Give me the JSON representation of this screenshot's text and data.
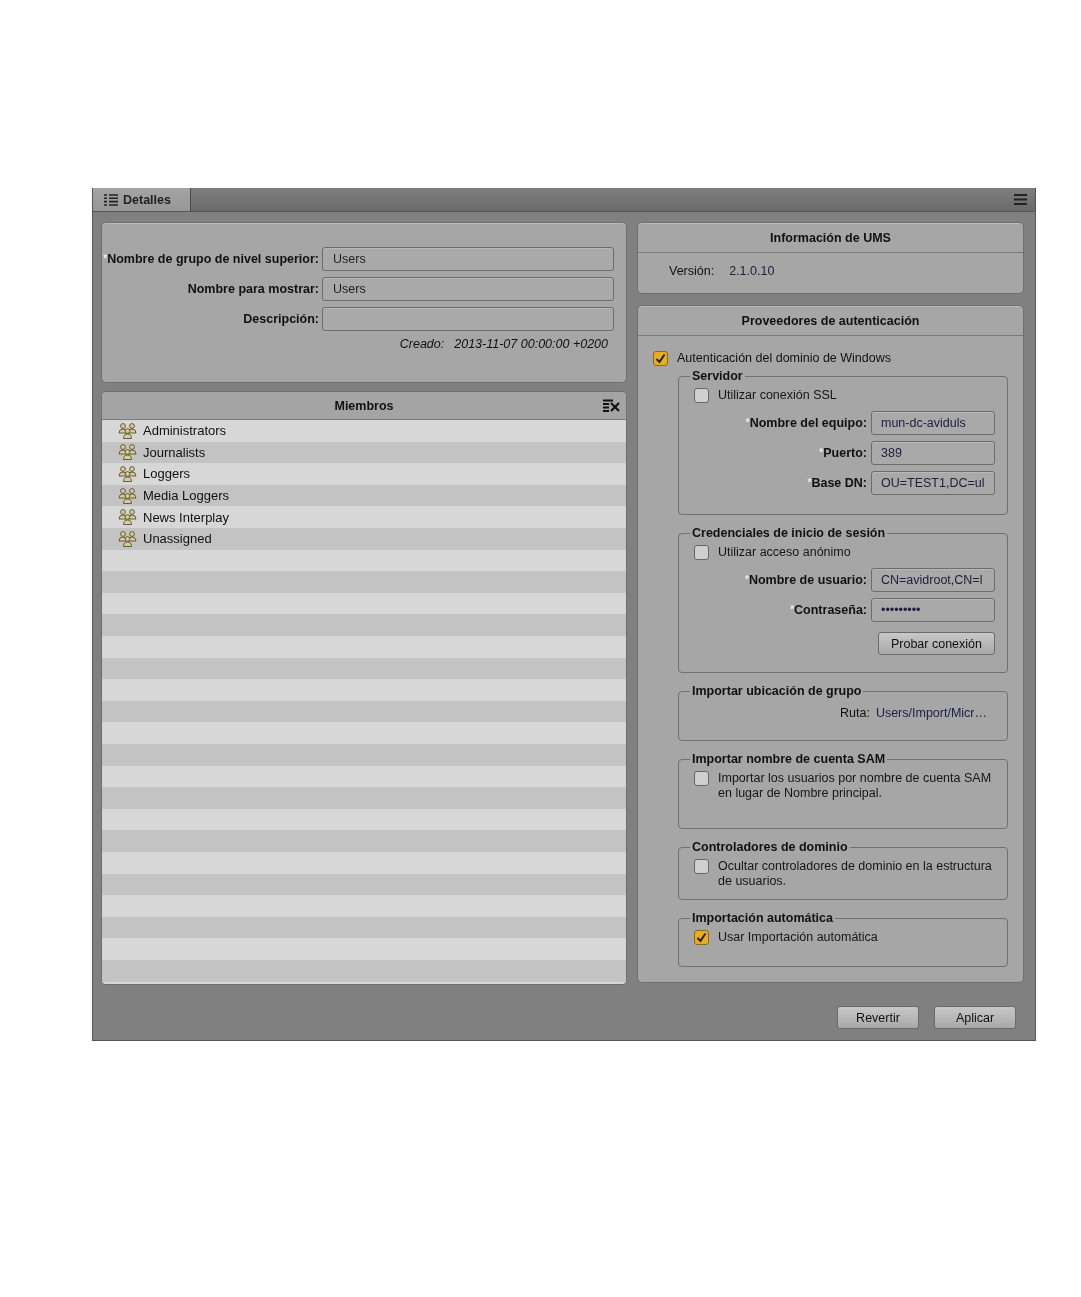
{
  "tab": {
    "label": "Detalles",
    "selected": true
  },
  "group_details": {
    "fields": [
      {
        "required_mark": "*",
        "label": "Nombre de grupo de nivel superior:",
        "value": "Users"
      },
      {
        "label": "Nombre para mostrar:",
        "value": "Users"
      },
      {
        "label": "Descripción:"
      }
    ],
    "created_label": "Creado:",
    "created_value": "2013-11-07 00:00:00 +0200"
  },
  "members": {
    "title": "Miembros",
    "items": [
      "Administrators",
      "Journalists",
      "Loggers",
      "Media Loggers",
      "News Interplay",
      "Unassigned"
    ]
  },
  "ums_info": {
    "title": "Información de UMS",
    "version_label": "Versión:",
    "version_value": "2.1.0.10"
  },
  "auth": {
    "title": "Proveedores de autenticación",
    "windows_domain": {
      "label": "Autenticación del dominio de Windows",
      "checked": true
    },
    "groups": [
      {
        "legend": "Servidor",
        "items": [
          {
            "kind": "checkbox",
            "label": "Utilizar conexión SSL",
            "checked": false
          },
          {
            "kind": "field",
            "required_mark": "*",
            "label": "Nombre del equipo:",
            "value": "mun-dc-aviduls"
          },
          {
            "kind": "field",
            "required_mark": "*",
            "label": "Puerto:",
            "value": "389"
          },
          {
            "kind": "field",
            "required_mark": "*",
            "label": "Base DN:",
            "value": "OU=TEST1,DC=ul"
          }
        ]
      },
      {
        "legend": "Credenciales de inicio de sesión",
        "items": [
          {
            "kind": "checkbox",
            "label": "Utilizar acceso anónimo",
            "checked": false
          },
          {
            "kind": "field",
            "required_mark": "*",
            "label": "Nombre de usuario:",
            "value": "CN=avidroot,CN=l"
          },
          {
            "kind": "field",
            "required_mark": "*",
            "label": "Contraseña:",
            "value": "•••••••••"
          },
          {
            "kind": "button",
            "label": "Probar conexión"
          }
        ]
      },
      {
        "legend": "Importar ubicación de grupo",
        "items": [
          {
            "kind": "path",
            "label": "Ruta:",
            "value": "Users/Import/Micr…"
          }
        ]
      },
      {
        "legend": "Importar nombre de cuenta SAM",
        "items": [
          {
            "kind": "checkbox",
            "label": "Importar los usuarios por nombre de cuenta SAM en lugar de Nombre principal.",
            "checked": false
          }
        ]
      },
      {
        "legend": "Controladores de dominio",
        "items": [
          {
            "kind": "checkbox",
            "label": "Ocultar controladores de dominio en la estructura de usuarios.",
            "checked": false
          }
        ]
      },
      {
        "legend": "Importación automática",
        "items": [
          {
            "kind": "checkbox",
            "label": "Usar Importación automática",
            "checked": true
          }
        ]
      }
    ]
  },
  "buttons": [
    {
      "label": "Revertir"
    },
    {
      "label": "Aplicar"
    }
  ]
}
